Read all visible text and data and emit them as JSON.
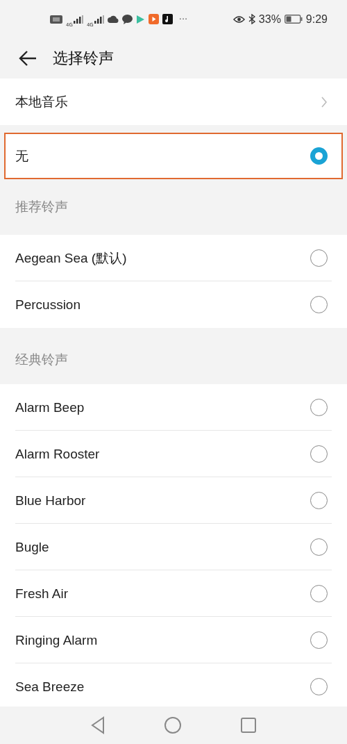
{
  "status_bar": {
    "network_labels": [
      "4G",
      "4G"
    ],
    "more": "···",
    "battery_percent": "33%",
    "time": "9:29"
  },
  "header": {
    "title": "选择铃声"
  },
  "local_music": {
    "label": "本地音乐"
  },
  "none_option": {
    "label": "无",
    "selected": true,
    "highlighted": true
  },
  "sections": [
    {
      "title": "推荐铃声",
      "items": [
        {
          "label": "Aegean Sea (默认)",
          "selected": false
        },
        {
          "label": "Percussion",
          "selected": false
        }
      ]
    },
    {
      "title": "经典铃声",
      "items": [
        {
          "label": "Alarm Beep",
          "selected": false
        },
        {
          "label": "Alarm Rooster",
          "selected": false
        },
        {
          "label": "Blue Harbor",
          "selected": false
        },
        {
          "label": "Bugle",
          "selected": false
        },
        {
          "label": "Fresh Air",
          "selected": false
        },
        {
          "label": "Ringing Alarm",
          "selected": false
        },
        {
          "label": "Sea Breeze",
          "selected": false
        }
      ]
    }
  ]
}
